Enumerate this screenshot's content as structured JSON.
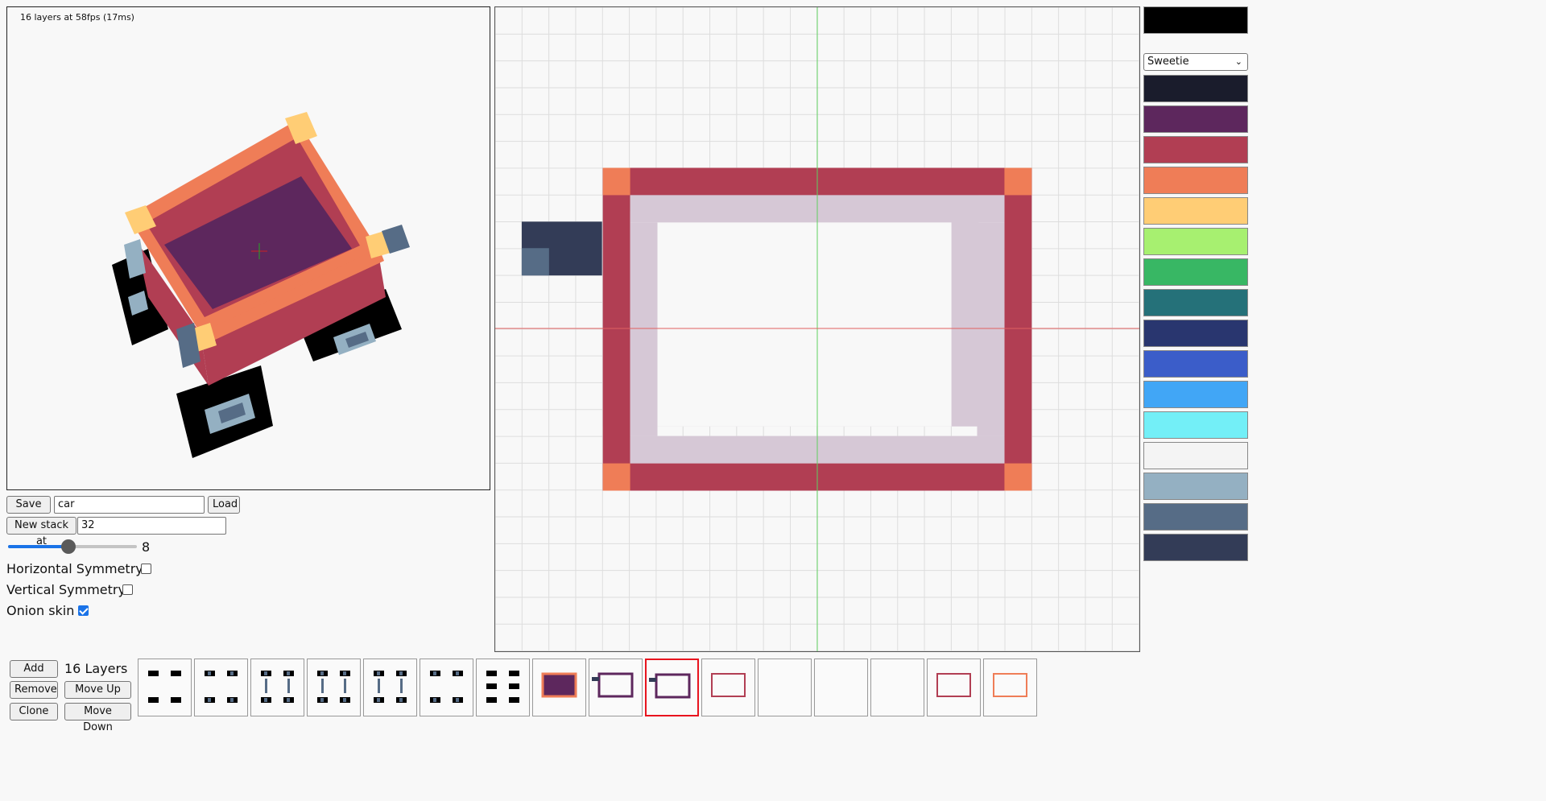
{
  "viewport": {
    "fps_text": "16 layers at 58fps (17ms)"
  },
  "controls": {
    "save_as_label": "Save as",
    "filename_value": "car",
    "load_label": "Load",
    "new_stack_label": "New stack at",
    "new_stack_value": "32",
    "slider_value": "8",
    "slider_fraction": 0.47,
    "horizontal_symmetry_label": "Horizontal Symmetry",
    "horizontal_symmetry_checked": false,
    "vertical_symmetry_label": "Vertical Symmetry",
    "vertical_symmetry_checked": false,
    "onion_skin_label": "Onion skin",
    "onion_skin_checked": true
  },
  "layers_panel": {
    "add_label": "Add",
    "remove_label": "Remove",
    "clone_label": "Clone",
    "move_up_label": "Move Up",
    "move_down_label": "Move Down",
    "count_text": "16 Layers",
    "selected_index": 9
  },
  "palette": {
    "current_color": "#000000",
    "selected_name": "Sweetie",
    "colors": [
      "#1a1c2c",
      "#5d275d",
      "#b13e53",
      "#ef7d57",
      "#ffcd75",
      "#a7f070",
      "#38b764",
      "#257179",
      "#29366f",
      "#3b5dc9",
      "#41a6f6",
      "#73eff7",
      "#f4f4f4",
      "#94b0c2",
      "#566c86",
      "#333c57"
    ]
  }
}
